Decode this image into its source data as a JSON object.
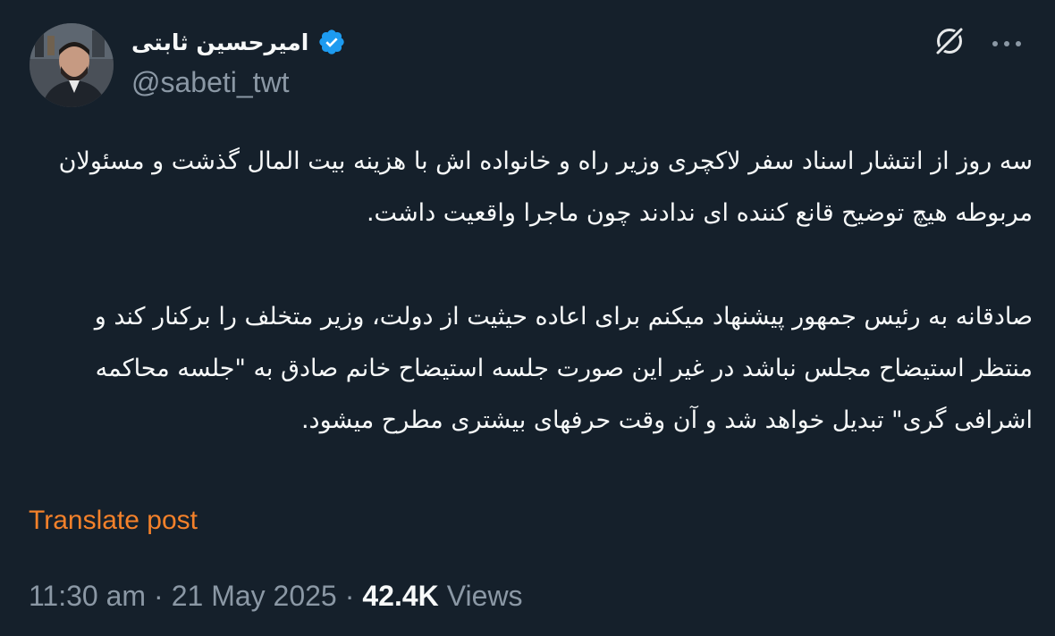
{
  "author": {
    "name": "امیرحسین ثابتی",
    "handle": "@sabeti_twt",
    "verified": true
  },
  "colors": {
    "background": "#15202b",
    "text_primary": "#f7f9f9",
    "text_secondary": "#8b98a5",
    "verified_badge": "#1d9bf0",
    "translate_link": "#f4812a"
  },
  "icons": {
    "grok": "grok-icon",
    "more": "more-icon",
    "verified": "verified-badge-icon"
  },
  "tweet": {
    "paragraphs": [
      "سه روز از انتشار اسناد سفر لاکچری وزیر راه و خانواده اش با هزینه بیت المال گذشت و مسئولان مربوطه هیچ توضیح قانع کننده ای ندادند چون ماجرا واقعیت داشت.",
      "صادقانه به رئیس جمهور پیشنهاد میکنم برای اعاده حیثیت از دولت، وزیر متخلف را برکنار کند و منتظر استیضاح مجلس نباشد در غیر این صورت جلسه استیضاح خانم صادق به \"جلسه محاکمه اشرافی گری\" تبدیل خواهد شد و آن وقت حرفهای بیشتری مطرح میشود."
    ],
    "translate_label": "Translate post"
  },
  "meta": {
    "time": "11:30 am",
    "separator": "·",
    "date": "21 May 2025",
    "views_count": "42.4K",
    "views_label": "Views"
  }
}
